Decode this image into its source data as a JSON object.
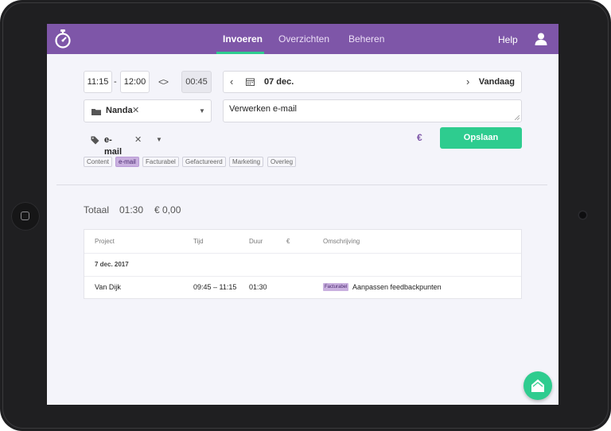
{
  "nav": {
    "tabs": [
      {
        "label": "Invoeren",
        "active": true
      },
      {
        "label": "Overzichten",
        "active": false
      },
      {
        "label": "Beheren",
        "active": false
      }
    ],
    "help_label": "Help",
    "accent_color": "#7e56a8",
    "active_underline_color": "#2ecc8f"
  },
  "entry": {
    "start_time": "11:15",
    "separator": "-",
    "end_time": "12:00",
    "duration": "00:45",
    "date": "07 dec.",
    "today_label": "Vandaag",
    "project": "Nanda",
    "description": "Verwerken e-mail",
    "tag": "e-mail",
    "currency_symbol": "€",
    "save_label": "Opslaan",
    "save_color": "#2ecc8f"
  },
  "tags": [
    {
      "label": "Content",
      "active": false
    },
    {
      "label": "e-mail",
      "active": true
    },
    {
      "label": "Facturabel",
      "active": false
    },
    {
      "label": "Gefactureerd",
      "active": false
    },
    {
      "label": "Marketing",
      "active": false
    },
    {
      "label": "Overleg",
      "active": false
    }
  ],
  "totals": {
    "label": "Totaal",
    "time": "01:30",
    "amount": "€ 0,00"
  },
  "table": {
    "headers": [
      "Project",
      "Tijd",
      "Duur",
      "€",
      "Omschrijving"
    ],
    "group_date": "7 dec. 2017",
    "rows": [
      {
        "project": "Van Dijk",
        "time": "09:45 – 11:15",
        "duration": "01:30",
        "amount": "",
        "tag": "Facturabel",
        "description": "Aanpassen feedbackpunten"
      }
    ]
  },
  "icons": {
    "logo": "stopwatch-icon",
    "user": "user-icon",
    "calendar": "calendar-icon",
    "folder": "folder-icon",
    "tag": "tag-icon",
    "fab": "home-icon"
  }
}
